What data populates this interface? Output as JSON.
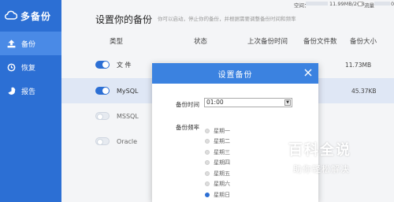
{
  "app": {
    "name": "多备份"
  },
  "sidebar": {
    "items": [
      {
        "label": "备份",
        "icon": "upload-icon",
        "active": true
      },
      {
        "label": "恢复",
        "icon": "restore-icon",
        "active": false
      },
      {
        "label": "报告",
        "icon": "pie-chart-icon",
        "active": false
      }
    ]
  },
  "usage": {
    "space_label": "空间：",
    "space_value": "11.99MB/2GB",
    "flow_label": "流量",
    "flow_value": "0/"
  },
  "page": {
    "title": "设置你的备份",
    "subtitle": "你可以启动，停止你的备份，并根据需要调整备份时间和频率"
  },
  "table": {
    "headers": [
      "类型",
      "状态",
      "上次备份时间",
      "备份文件数",
      "备份大小"
    ],
    "rows": [
      {
        "name": "文 件",
        "enabled": true,
        "files": "",
        "size": "11.73MB",
        "selected": false
      },
      {
        "name": "MySQL",
        "enabled": true,
        "files": "",
        "size": "45.37KB",
        "selected": true
      },
      {
        "name": "MSSQL",
        "enabled": false,
        "files": "",
        "size": "",
        "selected": false
      },
      {
        "name": "Oracle",
        "enabled": false,
        "files": "",
        "size": "",
        "selected": false
      }
    ]
  },
  "modal": {
    "title": "设置备份",
    "time_label": "备份时间",
    "time_value": "01:00",
    "freq_label": "备份频率",
    "days": [
      "星期一",
      "星期二",
      "星期三",
      "星期四",
      "星期五",
      "星期六",
      "星期日"
    ],
    "selected_day": "星期日"
  },
  "watermark": {
    "title": "百科全说",
    "subtitle": "助你轻松解决"
  },
  "colors": {
    "primary": "#2c6fd4",
    "modal_header": "#3b82e0",
    "selected_row": "#dfe7f5"
  }
}
